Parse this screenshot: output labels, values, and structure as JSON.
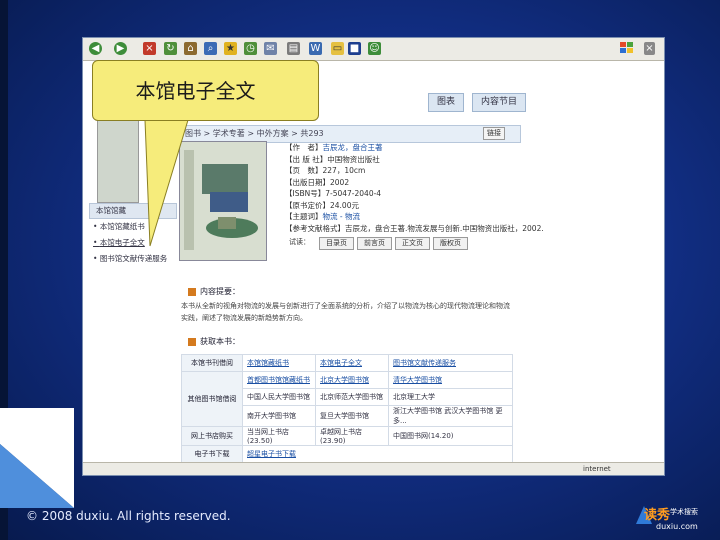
{
  "callout": {
    "text": "本馆电子全文"
  },
  "footer": {
    "copyright": "© 2008 duxiu. All rights reserved."
  },
  "logo": {
    "main": "读秀",
    "sub": "学术搜索",
    "url": "duxiu.com"
  },
  "browser": {
    "tabs": [
      "图表",
      "内容节目"
    ],
    "breadcrumb": "图书 > 学术专著 > 中外方案 > 共293",
    "link_btn": "链接",
    "status_right": "internet"
  },
  "book": {
    "info_lines": [
      {
        "label": "【作　者】",
        "value": "吉辰龙，盘合王著"
      },
      {
        "label": "【出 版 社】",
        "value": "中国物资出版社"
      },
      {
        "label": "【页　数】",
        "value": "227，10cm"
      },
      {
        "label": "【出版日期】",
        "value": "2002"
      },
      {
        "label": "【ISBN号】",
        "value": "7-5047-2040-4"
      },
      {
        "label": "【原书定价】",
        "value": "24.00元"
      },
      {
        "label": "【主题词】",
        "value": "物流 - 物流"
      },
      {
        "label": "【参考文献格式】",
        "value": "吉辰龙，盘合王著.物流发展与创新.中国物资出版社，2002."
      }
    ],
    "read_buttons": [
      "试读：",
      "目录页",
      "前言页",
      "正文页",
      "版权页"
    ]
  },
  "leftnav": {
    "header": "本馆馆藏",
    "items": [
      "本馆馆藏纸书",
      "本馆电子全文",
      "图书馆文献传递服务"
    ]
  },
  "sections": {
    "summary_title": "内容提要：",
    "summary_text": "本书从全新的视角对物流的发展与创新进行了全面系统的分析，介绍了以物流为核心的现代物流理论和物流实践，阐述了物流发展的新趋势新方向。",
    "sources_title": "获取本书："
  },
  "sources": [
    {
      "label": "本馆书刊借阅",
      "items": [
        "本馆馆藏纸书",
        "本馆电子全文",
        "图书馆文献传递服务"
      ]
    },
    {
      "label": "其他图书馆借阅",
      "items": [
        "首都图书馆馆藏纸书",
        "北京大学图书馆",
        "清华大学图书馆",
        "中国人民大学图书馆",
        "北京师范大学图书馆",
        "北京理工大学",
        "南开大学图书馆",
        "复旦大学图书馆",
        "浙江大学图书馆",
        "武汉大学图书馆"
      ],
      "more": "更多..."
    },
    {
      "label": "网上书店购买",
      "items": [
        "当当网上书店(23.50)",
        "卓越网上书店(23.90)",
        "中国图书网(14.20)"
      ]
    },
    {
      "label": "电子书下载",
      "items": [
        "超星电子书下载"
      ]
    }
  ]
}
